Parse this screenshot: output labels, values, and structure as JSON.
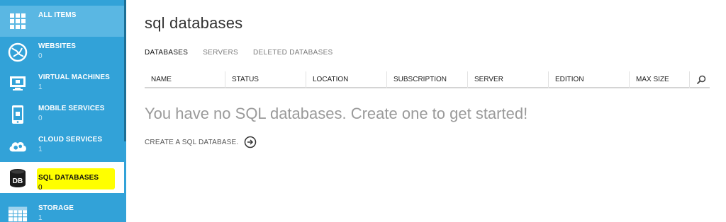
{
  "sidebar": {
    "items": [
      {
        "label": "ALL ITEMS",
        "count": ""
      },
      {
        "label": "WEBSITES",
        "count": "0"
      },
      {
        "label": "VIRTUAL MACHINES",
        "count": "1"
      },
      {
        "label": "MOBILE SERVICES",
        "count": "0"
      },
      {
        "label": "CLOUD SERVICES",
        "count": "1"
      },
      {
        "label": "SQL DATABASES",
        "count": "0"
      },
      {
        "label": "STORAGE",
        "count": "1"
      }
    ],
    "db_icon_text": "DB",
    "accent_color": "#32a2d8",
    "highlight_color": "#ffff00"
  },
  "main": {
    "title": "sql databases",
    "tabs": [
      "DATABASES",
      "SERVERS",
      "DELETED DATABASES"
    ],
    "columns": [
      "NAME",
      "STATUS",
      "LOCATION",
      "SUBSCRIPTION",
      "SERVER",
      "EDITION",
      "MAX SIZE"
    ],
    "empty_message": "You have no SQL databases. Create one to get started!",
    "create_label": "CREATE A SQL DATABASE."
  }
}
